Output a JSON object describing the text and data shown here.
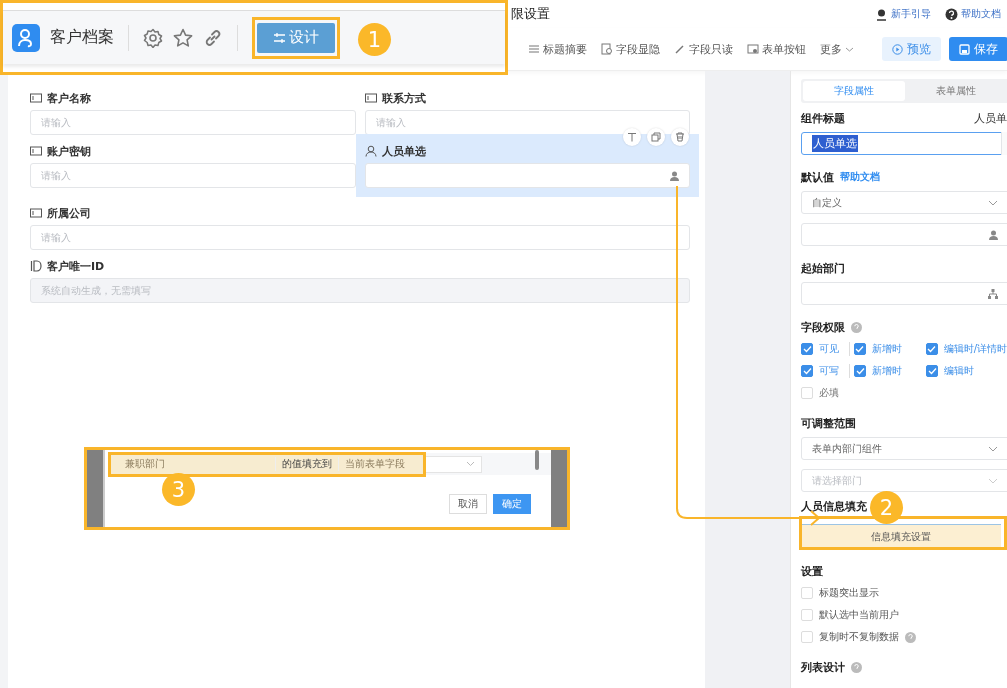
{
  "page_title": "限设置",
  "header_links": [
    {
      "label": "新手引导",
      "kind": "guide"
    },
    {
      "label": "帮助文档",
      "kind": "help"
    }
  ],
  "toolbar": {
    "items": [
      {
        "label": "标题摘要",
        "kind": "title"
      },
      {
        "label": "字段显隐",
        "kind": "visibility"
      },
      {
        "label": "字段只读",
        "kind": "readonly"
      },
      {
        "label": "表单按钮",
        "kind": "button"
      },
      {
        "label": "更多",
        "kind": "more"
      }
    ],
    "preview": "预览",
    "save": "保存"
  },
  "popup": {
    "app_name": "客户档案",
    "design_button": "设计"
  },
  "form": {
    "rows": [
      [
        {
          "label": "客户名称",
          "placeholder": "请输入",
          "kind": "text",
          "selected": false,
          "disabled": false
        },
        {
          "label": "联系方式",
          "placeholder": "请输入",
          "kind": "text",
          "selected": false,
          "disabled": false
        }
      ],
      [
        {
          "label": "账户密钥",
          "placeholder": "请输入",
          "kind": "text",
          "selected": false,
          "disabled": false
        },
        {
          "label": "人员单选",
          "kind": "person",
          "selected": true,
          "disabled": false
        }
      ],
      [
        {
          "label": "所属公司",
          "placeholder": "请输入",
          "kind": "text",
          "selected": false,
          "disabled": false
        }
      ],
      [
        {
          "label": "客户唯一ID",
          "placeholder": "系统自动生成，无需填写",
          "kind": "id",
          "selected": false,
          "disabled": true
        }
      ]
    ]
  },
  "dialog": {
    "source_field": "兼职部门",
    "connector": "的值填充到",
    "target_placeholder": "当前表单字段",
    "cancel": "取消",
    "confirm": "确定"
  },
  "panel": {
    "tabs": [
      {
        "label": "字段属性",
        "selected": true
      },
      {
        "label": "表单属性",
        "selected": false
      }
    ],
    "title_label": "组件标题",
    "title_preview": "人员单",
    "title_value": "人员单选",
    "title_highlighted": true,
    "default_label": "默认值",
    "default_link": "帮助文档",
    "default_select": "自定义",
    "start_dept_label": "起始部门",
    "permissions_label": "字段权限",
    "permissions": [
      [
        {
          "label": "可见",
          "checked": true
        },
        {
          "label": "新增时",
          "checked": true
        },
        {
          "label": "编辑时/详情时",
          "checked": true
        }
      ],
      [
        {
          "label": "可写",
          "checked": true
        },
        {
          "label": "新增时",
          "checked": true
        },
        {
          "label": "编辑时",
          "checked": true
        }
      ]
    ],
    "required": {
      "label": "必填",
      "checked": false
    },
    "range_label": "可调整范围",
    "range_select": "表单内部门组件",
    "dept_placeholder": "请选择部门",
    "fill_label": "人员信息填充",
    "fill_button": "信息填充设置",
    "settings_label": "设置",
    "settings": [
      {
        "label": "标题突出显示",
        "checked": false,
        "help": false
      },
      {
        "label": "默认选中当前用户",
        "checked": false,
        "help": false
      },
      {
        "label": "复制时不复制数据",
        "checked": false,
        "help": true
      }
    ],
    "list_design": "列表设计"
  },
  "annotations": [
    {
      "number": "1"
    },
    {
      "number": "2"
    },
    {
      "number": "3"
    }
  ]
}
